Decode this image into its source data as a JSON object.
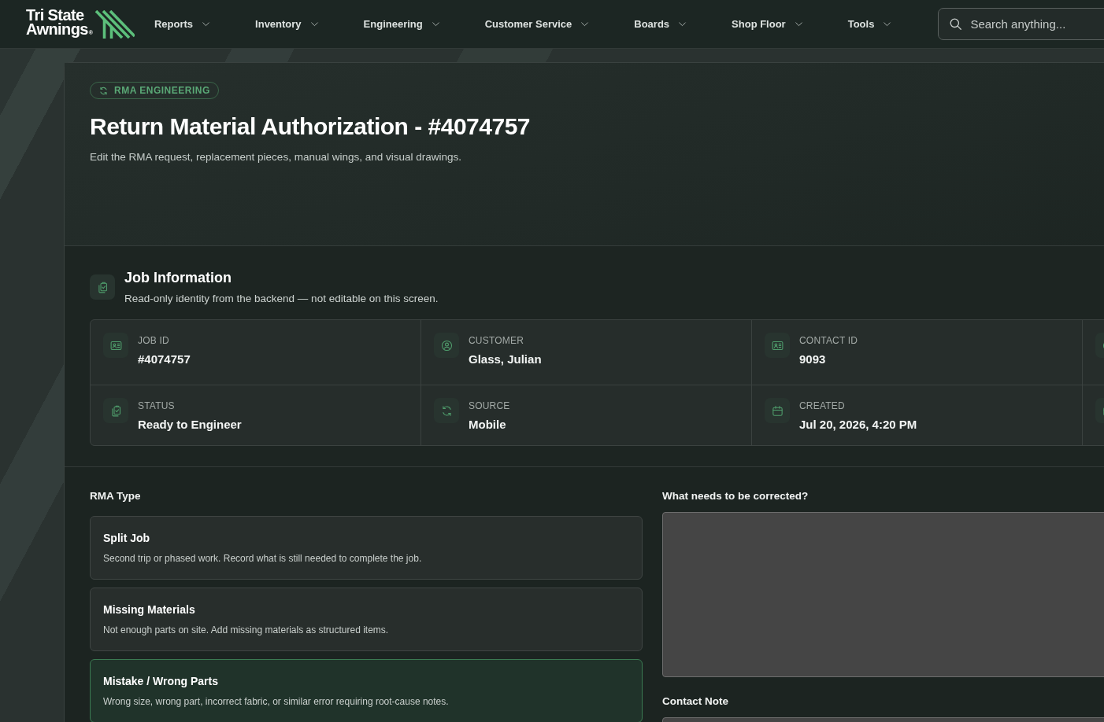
{
  "nav": {
    "logo": {
      "lines": [
        "Tri State",
        "Awnings"
      ],
      "mark": "®"
    },
    "menu": [
      "Reports",
      "Inventory",
      "Engineering",
      "Customer Service",
      "Boards",
      "Shop Floor",
      "Tools"
    ],
    "search": {
      "placeholder": "Search anything..."
    }
  },
  "header": {
    "tag": "RMA ENGINEERING",
    "title": "Return Material Authorization - #4074757",
    "subtitle": "Edit the RMA request, replacement pieces, manual wings, and visual drawings."
  },
  "job_information": {
    "title": "Job Information",
    "subtitle": "Read-only identity from the backend — not editable on this screen.",
    "rows": [
      [
        {
          "label": "JOB ID",
          "value": "#4074757"
        },
        {
          "label": "CUSTOMER",
          "value": "Glass, Julian"
        },
        {
          "label": "CONTACT ID",
          "value": "9093"
        }
      ],
      [
        {
          "label": "STATUS",
          "value": "Ready to Engineer"
        },
        {
          "label": "SOURCE",
          "value": "Mobile"
        },
        {
          "label": "CREATED",
          "value": "Jul 20, 2026, 4:20 PM"
        }
      ]
    ]
  },
  "rma_type": {
    "label": "RMA Type",
    "options": [
      {
        "title": "Split Job",
        "description": "Second trip or phased work. Record what is still needed to complete the job.",
        "selected": false
      },
      {
        "title": "Missing Materials",
        "description": "Not enough parts on site. Add missing materials as structured items.",
        "selected": false
      },
      {
        "title": "Mistake / Wrong Parts",
        "description": "Wrong size, wrong part, incorrect fabric, or similar error requiring root-cause notes.",
        "selected": true
      }
    ]
  },
  "correction": {
    "label": "What needs to be corrected?"
  },
  "contact_note": {
    "label": "Contact Note"
  }
}
